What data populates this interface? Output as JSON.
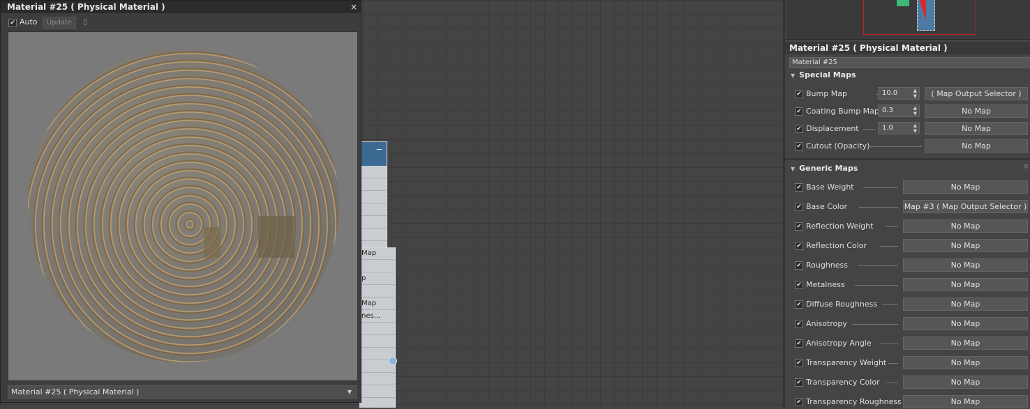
{
  "preview": {
    "title": "Material #25  ( Physical Material )",
    "close": "×",
    "auto_label": "Auto",
    "auto_checked": true,
    "update_label": "Update",
    "dropdown_value": "Material #25  ( Physical Material )"
  },
  "node": {
    "rows": [
      "",
      "",
      "",
      "",
      "",
      "",
      "",
      "Map",
      "",
      "p",
      "",
      "Map",
      "nes..."
    ]
  },
  "panel": {
    "title": "Material #25  ( Physical Material )",
    "name_value": "Material #25",
    "special_maps": {
      "header": "Special Maps",
      "rows": [
        {
          "label": "Bump Map",
          "amount": "10.0",
          "map": "( Map Output Selector )"
        },
        {
          "label": "Coating Bump Map",
          "amount": "0.3",
          "map": "No Map"
        },
        {
          "label": "Displacement",
          "amount": "1.0",
          "map": "No Map"
        },
        {
          "label": "Cutout (Opacity)",
          "amount": "",
          "map": "No Map"
        }
      ]
    },
    "generic_maps": {
      "header": "Generic Maps",
      "rows": [
        {
          "label": "Base Weight",
          "map": "No Map"
        },
        {
          "label": "Base Color",
          "map": "Map #3  ( Map Output Selector )"
        },
        {
          "label": "Reflection Weight",
          "map": "No Map"
        },
        {
          "label": "Reflection Color",
          "map": "No Map"
        },
        {
          "label": "Roughness",
          "map": "No Map"
        },
        {
          "label": "Metalness",
          "map": "No Map"
        },
        {
          "label": "Diffuse Roughness",
          "map": "No Map"
        },
        {
          "label": "Anisotropy",
          "map": "No Map"
        },
        {
          "label": "Anisotropy Angle",
          "map": "No Map"
        },
        {
          "label": "Transparency Weight",
          "map": "No Map"
        },
        {
          "label": "Transparency Color",
          "map": "No Map"
        },
        {
          "label": "Transparency Roughness",
          "map": "No Map"
        }
      ]
    }
  },
  "icons": {
    "check": "✔",
    "collapse": "▼",
    "dropdown": "▼",
    "spinner": "▲▼",
    "grip": "⠿"
  }
}
